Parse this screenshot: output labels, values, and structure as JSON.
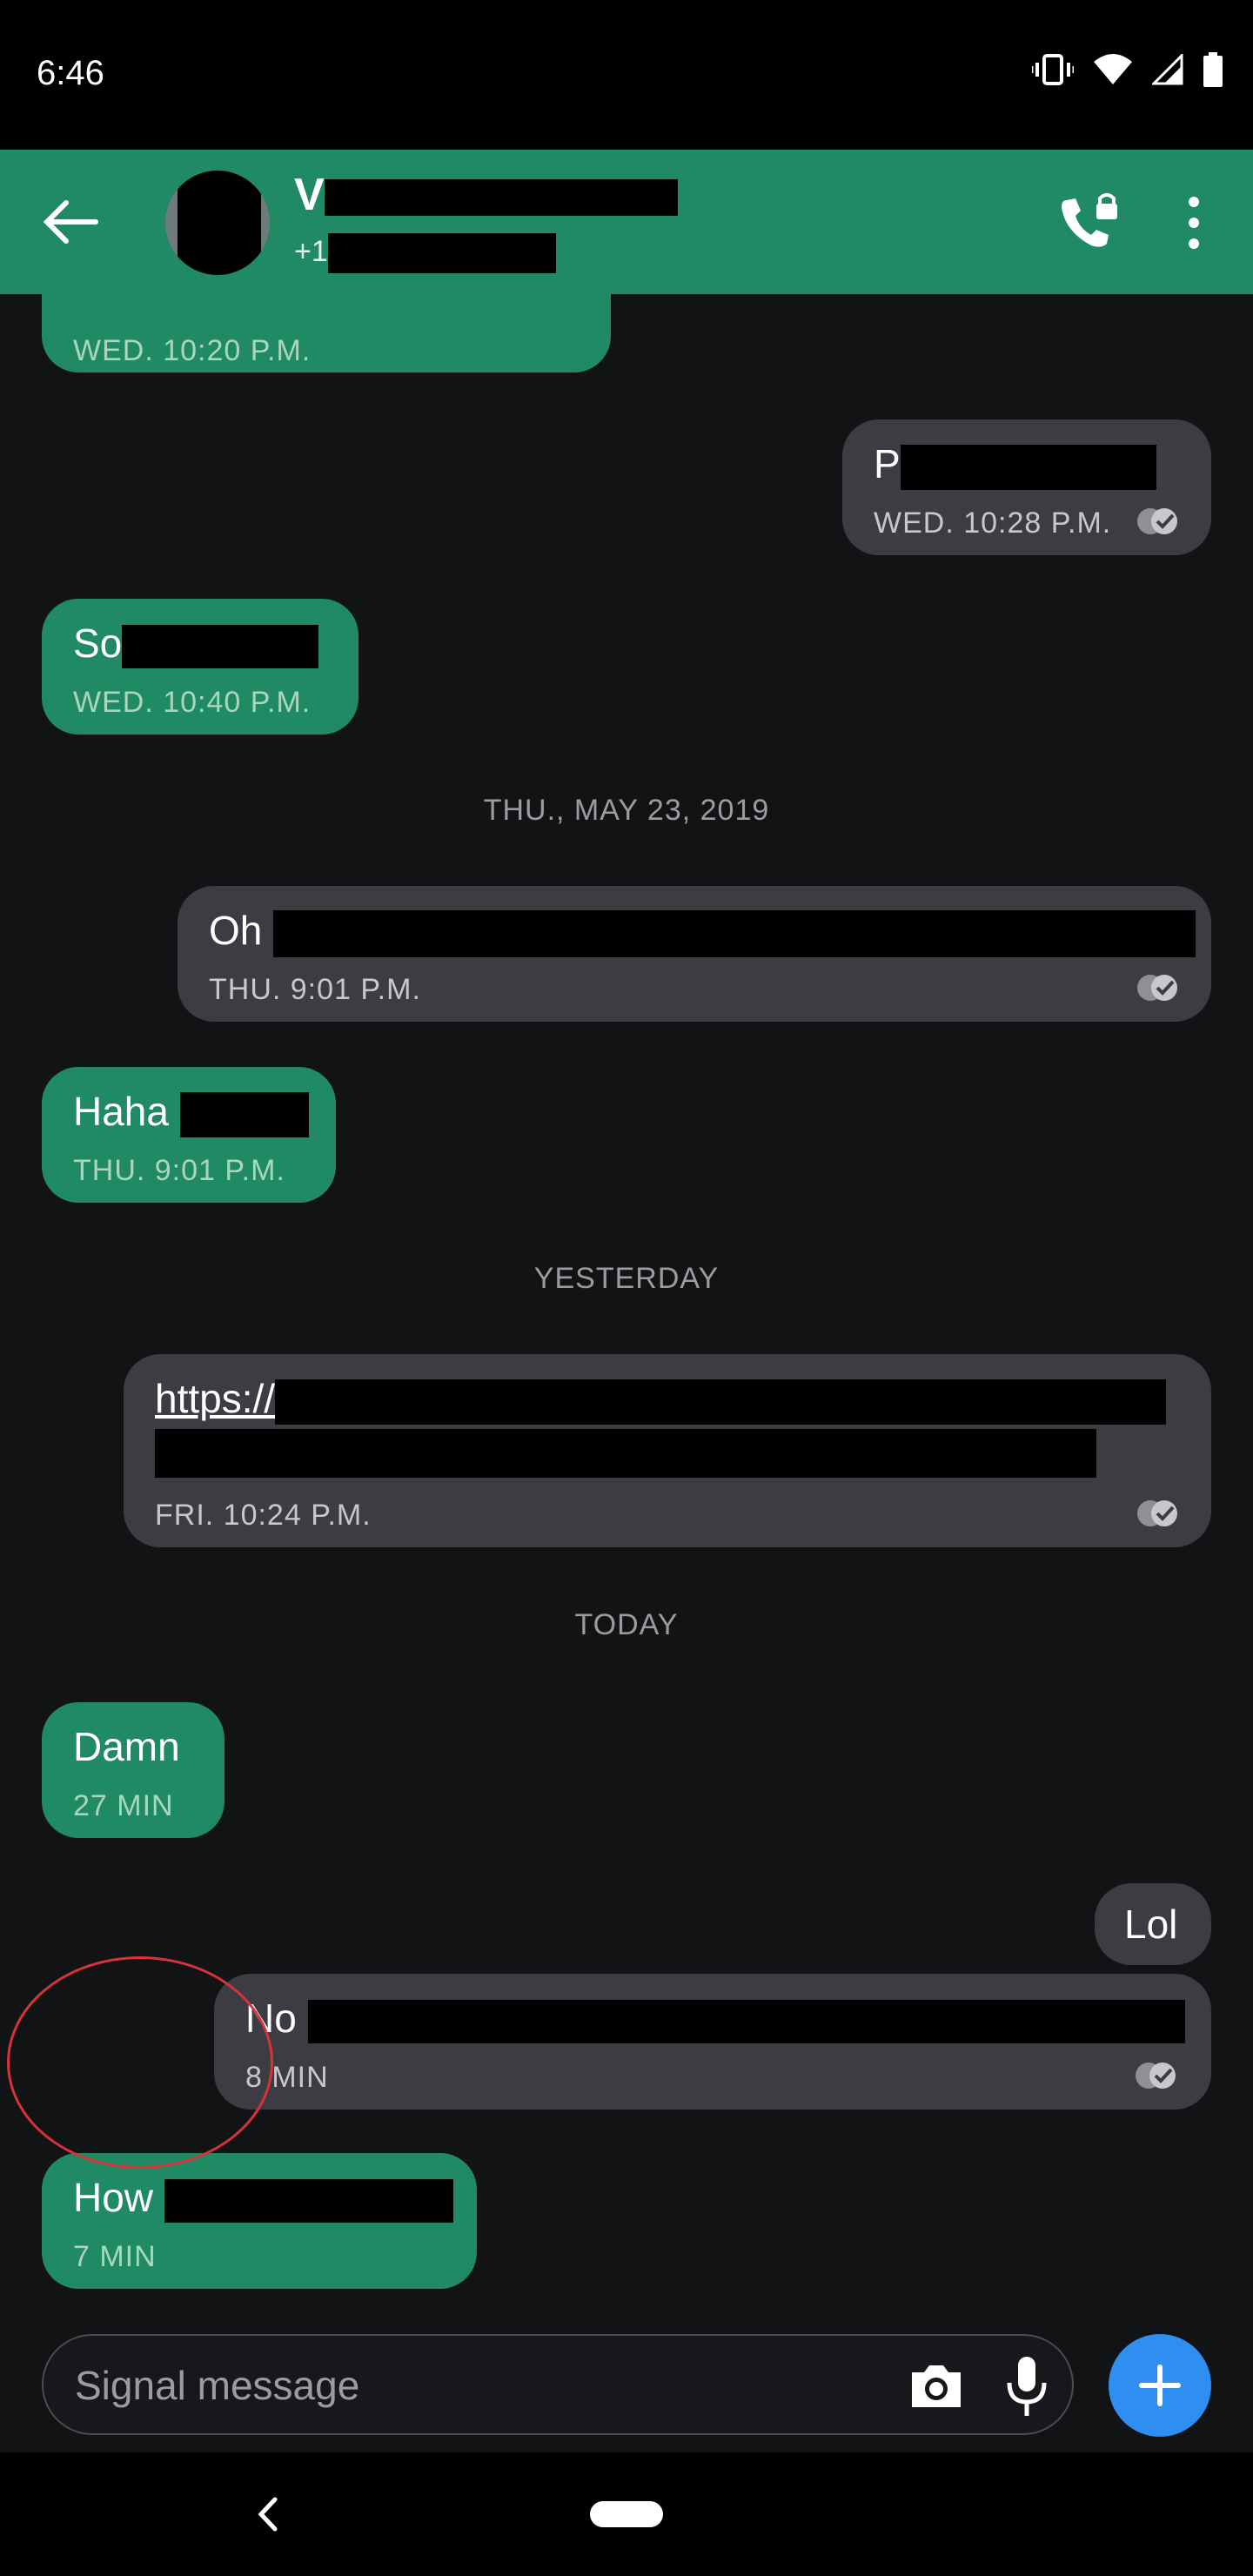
{
  "status": {
    "time": "6:46"
  },
  "header": {
    "name_visible": "V",
    "number_visible": "+1"
  },
  "messages": [
    {
      "text": "",
      "meta": "WED. 10:20 P.M."
    },
    {
      "text": "P",
      "meta": "WED. 10:28 P.M."
    },
    {
      "text": "So",
      "meta": "WED. 10:40 P.M."
    },
    {
      "divider": "THU., MAY 23, 2019"
    },
    {
      "text": "Oh",
      "meta": "THU. 9:01 P.M."
    },
    {
      "text": "Haha",
      "meta": "THU. 9:01 P.M."
    },
    {
      "divider": "YESTERDAY"
    },
    {
      "text": "https://",
      "meta": "FRI. 10:24 P.M."
    },
    {
      "divider": "TODAY"
    },
    {
      "text": "Damn",
      "meta": "27 MIN"
    },
    {
      "text": "Lol"
    },
    {
      "text": "No",
      "meta": "8 MIN"
    },
    {
      "text": "How",
      "meta": "7 MIN"
    }
  ],
  "composer": {
    "placeholder": "Signal message"
  },
  "colors": {
    "incoming": "#1f8a63",
    "outgoing": "#3b3d42",
    "accent": "#2f8ff0",
    "highlight": "#d8323a"
  },
  "icons": {
    "back": "arrow-left-icon",
    "call": "phone-lock-icon",
    "menu": "more-vertical-icon",
    "camera": "camera-icon",
    "mic": "microphone-icon",
    "add": "plus-icon",
    "read": "double-check-icon"
  }
}
